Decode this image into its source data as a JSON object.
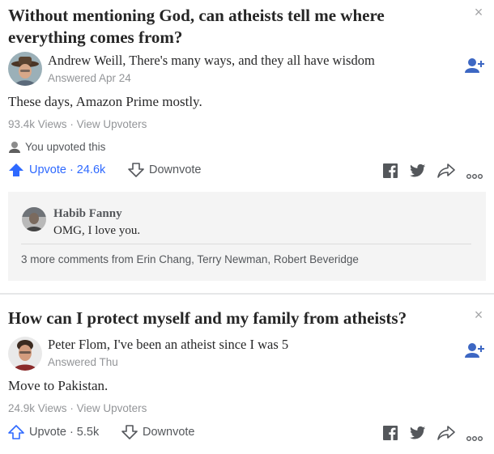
{
  "feed": [
    {
      "question": "Without mentioning God, can atheists tell me where everything comes from?",
      "close_glyph": "×",
      "author": "Andrew Weill, There's many ways, and they all have wisdom",
      "answered": "Answered Apr 24",
      "answer": "These days, Amazon Prime mostly.",
      "views": "93.4k Views",
      "dot": "·",
      "view_upvoters": "View Upvoters",
      "you_upvoted": "You upvoted this",
      "upvote_label": "Upvote",
      "upvote_count": "24.6k",
      "upvote_active": true,
      "downvote_label": "Downvote",
      "comment": {
        "author": "Habib Fanny",
        "text": "OMG, I love you.",
        "more": "3 more comments from Erin Chang, Terry Newman, Robert Beveridge"
      }
    },
    {
      "question": "How can I protect myself and my family from atheists?",
      "close_glyph": "×",
      "author": "Peter Flom, I've been an atheist since I was 5",
      "answered": "Answered Thu",
      "answer": "Move to Pakistan.",
      "views": "24.9k Views",
      "dot": "·",
      "view_upvoters": "View Upvoters",
      "upvote_label": "Upvote",
      "upvote_count": "5.5k",
      "upvote_active": false,
      "downvote_label": "Downvote"
    }
  ],
  "icons": [
    "close-icon",
    "follow-user-icon",
    "upvote-arrow-icon",
    "downvote-arrow-icon",
    "facebook-icon",
    "twitter-icon",
    "share-arrow-icon",
    "more-options-icon"
  ],
  "colors": {
    "accent_blue": "#2e69ff",
    "follow_blue": "#3d67c3",
    "icon_gray": "#54575b",
    "meta_gray": "#939598",
    "comment_bg": "#f4f4f4"
  }
}
